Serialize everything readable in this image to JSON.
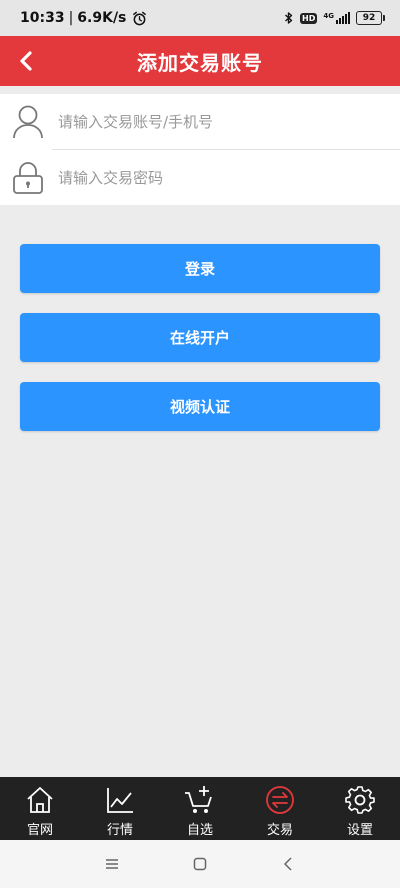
{
  "status_bar": {
    "time": "10:33",
    "separator": "|",
    "speed": "6.9K/s",
    "network": "4G",
    "battery": "92"
  },
  "header": {
    "title": "添加交易账号"
  },
  "form": {
    "account_placeholder": "请输入交易账号/手机号",
    "password_placeholder": "请输入交易密码"
  },
  "buttons": {
    "login": "登录",
    "open_account": "在线开户",
    "video_verify": "视频认证"
  },
  "bottom_nav": {
    "items": [
      {
        "label": "官网",
        "icon": "home-icon"
      },
      {
        "label": "行情",
        "icon": "chart-icon"
      },
      {
        "label": "自选",
        "icon": "cart-add-icon"
      },
      {
        "label": "交易",
        "icon": "exchange-icon"
      },
      {
        "label": "设置",
        "icon": "gear-icon"
      }
    ],
    "active_index": 3
  },
  "colors": {
    "header": "#e4393c",
    "button": "#2b94ff",
    "nav_bg": "#222222",
    "active_icon": "#e4393c"
  }
}
